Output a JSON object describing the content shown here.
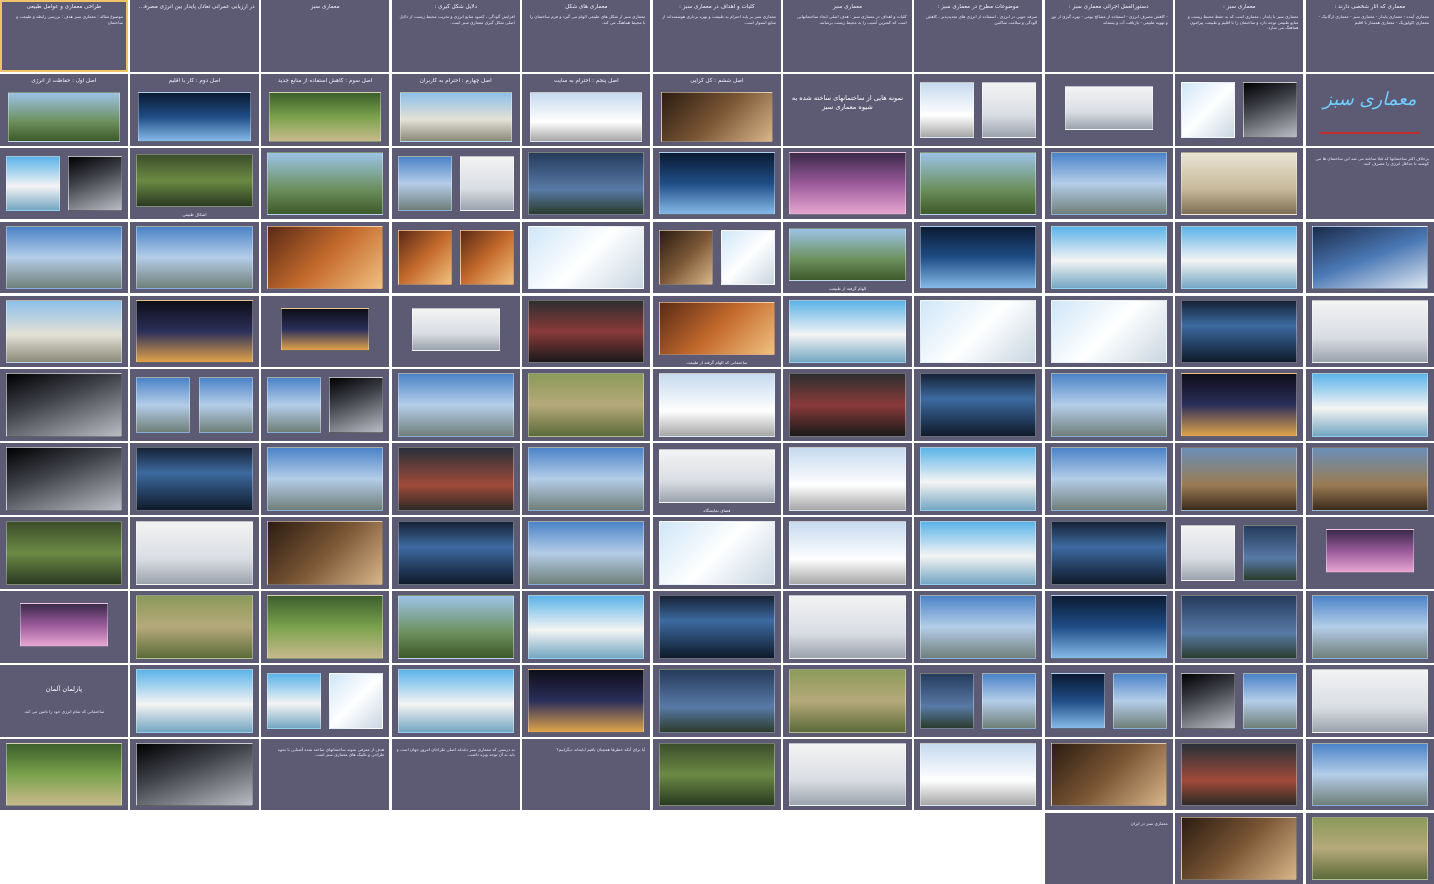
{
  "accent_colors": {
    "slide_bg": "#5d5a74",
    "logo_line": "#c0302a",
    "logo_text": "#6fd0ff",
    "canvas": "#ffffff"
  },
  "logo_text": "معماری سبز",
  "slides": [
    {
      "title": "معماری که اثار شخصی دارند :",
      "body": "معماری آینده - معماری پایدار - معماری سبز - معماری ارگانیک - معماری اکولوژیک - معماری همساز با اقلیم"
    },
    {
      "title": "معماری سبز :",
      "body": "معماری سبز یا پایدار ، معماری است که به حفظ محیط زیست و منابع طبیعی توجه دارد و ساختمان را با اقلیم و طبیعت پیرامون هماهنگ می سازد."
    },
    {
      "title": "دستورالعمل اجرائی معماری سبز :",
      "body": "- کاهش مصرف انرژی - استفاده از مصالح بومی - بهره گیری از نور و تهویه طبیعی - بازیافت آب و پسماند"
    },
    {
      "title": "موضوعات مطرح در معماری سبز :",
      "body": "صرفه جویی در انرژی ، استفاده از انرژی های تجدیدپذیر ، کاهش آلودگی و سلامت ساکنین"
    },
    {
      "title": "معماری سبز",
      "body": "کلیات و اهداف در معماری سبز : هدف اصلی ایجاد ساختمانهایی است که کمترین آسیب را به محیط زیست برسانند."
    },
    {
      "title": "کلیات و اهداف در معماری سبز :",
      "body": "معماری سبز بر پایه احترام به طبیعت و بهره برداری هوشمندانه از منابع استوار است."
    },
    {
      "title": "معماری های شکل",
      "body": "معماری سبز از شکل های طبیعی الهام می گیرد و فرم ساختمان را با محیط هماهنگ می کند."
    },
    {
      "title": "دلایل شکل گیری :",
      "body": "افزایش آلودگی ، کمبود منابع انرژی و تخریب محیط زیست از دلایل اصلی شکل گیری معماری سبز است."
    },
    {
      "title": "معماری سبز",
      "body": ""
    },
    {
      "title": "در ارزیابی عمرانی تعادل پایدار بین انرژی مصرفی و پایداری طبیعت را باید هدف گرفت",
      "body": ""
    },
    {
      "title": "طراحی معماری و عوامل طبیعی",
      "body": "موضوع مقاله : معماری سبز\nهدف : بررسی رابطه و طبیعت و ساختمان"
    },
    {
      "logo": true
    },
    {
      "title": "",
      "pics": [
        "g10",
        "g16"
      ],
      "split": true
    },
    {
      "title": "",
      "pics": [
        "g7"
      ],
      "size": "small"
    },
    {
      "title": "",
      "pics": [
        "g7",
        "g11"
      ],
      "split": true
    },
    {
      "bigtext": "نمونه هایی از ساختمانهای ساخته شده به شیوه معماری سبز"
    },
    {
      "title": "اصل ششم : کل گرایی",
      "pics": [
        "g12"
      ],
      "size": "low"
    },
    {
      "title": "اصل پنجم : احترام به سایت",
      "pics": [
        "g11"
      ],
      "size": "low"
    },
    {
      "title": "اصل چهارم : احترام به کاربران",
      "pics": [
        "g3"
      ],
      "size": "low"
    },
    {
      "title": "اصل سوم : کاهش استفاده از منابع جدید",
      "pics": [
        "g4"
      ],
      "size": "low"
    },
    {
      "title": "اصل دوم : کار با اقلیم",
      "pics": [
        "g6"
      ],
      "size": "low"
    },
    {
      "title": "اصل اول : حفاظت از انرژی",
      "pics": [
        "g9"
      ],
      "size": "low"
    },
    {
      "title": "",
      "body": "برخلاف اکثر ساختمانها که قبلا ساخته می شد این ساختمان ها می کوشند تا حداقل انرژی را مصرف کنند."
    },
    {
      "title": "",
      "pics": [
        "g15"
      ]
    },
    {
      "title": "",
      "pics": [
        "g13"
      ]
    },
    {
      "title": "",
      "pics": [
        "g9"
      ]
    },
    {
      "title": "",
      "pics": [
        "g22"
      ]
    },
    {
      "title": "",
      "pics": [
        "g6"
      ]
    },
    {
      "title": "",
      "pics": [
        "g8"
      ],
      "caption": ""
    },
    {
      "title": "",
      "pics": [
        "g7",
        "g13"
      ],
      "split": true
    },
    {
      "title": "",
      "pics": [
        "g9"
      ]
    },
    {
      "title": "",
      "pics": [
        "g24"
      ],
      "caption": "اشکال طبیعی"
    },
    {
      "title": "",
      "pics": [
        "g10",
        "g20"
      ],
      "split": true
    },
    {
      "title": "",
      "pics": [
        "g2"
      ]
    },
    {
      "title": "",
      "pics": [
        "g20"
      ]
    },
    {
      "title": "",
      "pics": [
        "g20"
      ]
    },
    {
      "title": "",
      "pics": [
        "g6"
      ]
    },
    {
      "title": "",
      "pics": [
        "g9"
      ],
      "caption": "الهام گرفته از طبیعت"
    },
    {
      "title": "",
      "pics": [
        "g16",
        "g12"
      ],
      "split": true
    },
    {
      "title": "",
      "pics": [
        "g16"
      ]
    },
    {
      "title": "",
      "pics": [
        "g5",
        "g5"
      ],
      "split": true
    },
    {
      "title": "",
      "pics": [
        "g5"
      ]
    },
    {
      "title": "",
      "pics": [
        "g13"
      ]
    },
    {
      "title": "",
      "pics": [
        "g13"
      ]
    },
    {
      "title": "",
      "pics": [
        "g7"
      ]
    },
    {
      "title": "",
      "pics": [
        "g18"
      ]
    },
    {
      "title": "",
      "pics": [
        "g16"
      ]
    },
    {
      "title": "",
      "pics": [
        "g16"
      ],
      "caption": ""
    },
    {
      "title": "",
      "pics": [
        "g20"
      ]
    },
    {
      "title": "",
      "pics": [
        "g5"
      ],
      "caption": "ساختمانی که الهام گرفته از طبیعت"
    },
    {
      "title": "",
      "pics": [
        "g21"
      ]
    },
    {
      "title": "",
      "pics": [
        "g7"
      ],
      "size": "small"
    },
    {
      "title": "",
      "pics": [
        "g14"
      ],
      "size": "small"
    },
    {
      "title": "",
      "pics": [
        "g14"
      ]
    },
    {
      "title": "",
      "pics": [
        "g3"
      ]
    },
    {
      "title": "",
      "pics": [
        "g20"
      ]
    },
    {
      "title": "",
      "pics": [
        "g14"
      ],
      "caption": ""
    },
    {
      "title": "",
      "pics": [
        "g13"
      ]
    },
    {
      "title": "",
      "pics": [
        "g18"
      ]
    },
    {
      "title": "",
      "pics": [
        "g21"
      ]
    },
    {
      "title": "",
      "pics": [
        "g11"
      ]
    },
    {
      "title": "",
      "pics": [
        "g19"
      ]
    },
    {
      "title": "",
      "pics": [
        "g13"
      ]
    },
    {
      "title": "",
      "pics": [
        "g10",
        "g13"
      ],
      "split": true
    },
    {
      "title": "",
      "pics": [
        "g13",
        "g13"
      ],
      "split": true
    },
    {
      "title": "",
      "pics": [
        "g10"
      ]
    },
    {
      "title": "",
      "pics": [
        "g17"
      ]
    },
    {
      "title": "",
      "pics": [
        "g17"
      ]
    },
    {
      "title": "",
      "pics": [
        "g13"
      ]
    },
    {
      "title": "",
      "pics": [
        "g20"
      ],
      "caption": ""
    },
    {
      "title": "",
      "pics": [
        "g11"
      ]
    },
    {
      "title": "",
      "pics": [
        "g7"
      ],
      "caption": "فضای نمایشگاه"
    },
    {
      "title": "",
      "pics": [
        "g13"
      ],
      "caption": ""
    },
    {
      "title": "",
      "pics": [
        "g23"
      ]
    },
    {
      "title": "",
      "pics": [
        "g13"
      ]
    },
    {
      "title": "",
      "pics": [
        "g18"
      ]
    },
    {
      "title": "",
      "pics": [
        "g10"
      ]
    },
    {
      "title": "",
      "pics": [
        "g22"
      ],
      "size": "small"
    },
    {
      "title": "",
      "pics": [
        "g8",
        "g7"
      ],
      "split": true
    },
    {
      "title": "",
      "pics": [
        "g18"
      ]
    },
    {
      "title": "",
      "pics": [
        "g20"
      ],
      "caption": ""
    },
    {
      "title": "",
      "pics": [
        "g11"
      ]
    },
    {
      "title": "",
      "pics": [
        "g16"
      ]
    },
    {
      "title": "",
      "pics": [
        "g13"
      ]
    },
    {
      "title": "",
      "pics": [
        "g18"
      ]
    },
    {
      "title": "",
      "pics": [
        "g12"
      ]
    },
    {
      "title": "",
      "pics": [
        "g7"
      ]
    },
    {
      "title": "",
      "pics": [
        "g24"
      ]
    },
    {
      "title": "",
      "pics": [
        "g13"
      ]
    },
    {
      "title": "",
      "pics": [
        "g8"
      ]
    },
    {
      "title": "",
      "pics": [
        "g6"
      ]
    },
    {
      "title": "",
      "pics": [
        "g13"
      ]
    },
    {
      "title": "",
      "pics": [
        "g7"
      ]
    },
    {
      "title": "",
      "pics": [
        "g18"
      ]
    },
    {
      "title": "",
      "pics": [
        "g20"
      ]
    },
    {
      "title": "",
      "pics": [
        "g9"
      ]
    },
    {
      "title": "",
      "pics": [
        "g4"
      ]
    },
    {
      "title": "",
      "pics": [
        "g19"
      ],
      "caption": ""
    },
    {
      "title": "",
      "pics": [
        "g22"
      ],
      "size": "small"
    },
    {
      "title": "",
      "pics": [
        "g7"
      ]
    },
    {
      "title": "",
      "pics": [
        "g13",
        "g10"
      ],
      "split": true
    },
    {
      "title": "",
      "pics": [
        "g13",
        "g6"
      ],
      "split": true
    },
    {
      "title": "",
      "pics": [
        "g13",
        "g8"
      ],
      "split": true
    },
    {
      "title": "",
      "pics": [
        "g19"
      ]
    },
    {
      "title": "",
      "pics": [
        "g8"
      ]
    },
    {
      "title": "",
      "pics": [
        "g14"
      ]
    },
    {
      "title": "",
      "pics": [
        "g20"
      ]
    },
    {
      "title": "",
      "pics": [
        "g16",
        "g20"
      ],
      "split": true
    },
    {
      "title": "",
      "pics": [
        "g20"
      ]
    },
    {
      "bigtext": "پارلمان آلمان",
      "body": "ساختمانی که تمام انرژی خود را تامین می کند."
    },
    {
      "title": "",
      "pics": [
        "g13"
      ]
    },
    {
      "title": "",
      "pics": [
        "g23"
      ]
    },
    {
      "title": "",
      "pics": [
        "g12"
      ]
    },
    {
      "title": "",
      "pics": [
        "g11"
      ]
    },
    {
      "title": "",
      "pics": [
        "g7"
      ]
    },
    {
      "title": "",
      "pics": [
        "g24"
      ]
    },
    {
      "title": "",
      "body": "آیا برای آنکه خطرها همچنان باقیم ابایماند دیگرانیم؟"
    },
    {
      "title": "",
      "body": "به درستی که معماری سبز دغدغه اصلی طراحان امروز جهان است و باید به آن توجه ویژه داشت."
    },
    {
      "title": "",
      "body": "هدف از معرفی نمونه ساختمانهای ساخته شده آشنایی با نحوه طراحی و تکنیک های معماری سبز است."
    },
    {
      "title": "",
      "pics": [
        "g10"
      ]
    },
    {
      "title": "",
      "pics": [
        "g4"
      ]
    },
    {
      "title": "",
      "pics": [
        "g19"
      ]
    },
    {
      "title": "",
      "pics": [
        "g12"
      ]
    },
    {
      "title": "",
      "body": "معماری سبز در ایران"
    }
  ]
}
